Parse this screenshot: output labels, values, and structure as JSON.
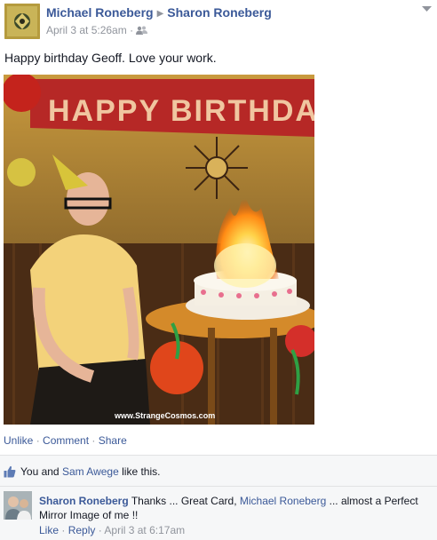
{
  "post": {
    "author": "Michael Roneberg",
    "arrow_glyph": "▶",
    "recipient": "Sharon Roneberg",
    "timestamp": "April 3 at 5:26am",
    "meta_separator": "·",
    "audience_icon": "friends-icon",
    "menu_icon": "chevron-down-icon",
    "message": "Happy birthday Geoff. Love your work.",
    "photo": {
      "banner_text": "HAPPY BIRTHDAY",
      "watermark": "www.StrangeCosmos.com"
    },
    "actions": {
      "like": "Unlike",
      "comment": "Comment",
      "share": "Share",
      "separator": "·"
    }
  },
  "likes": {
    "icon": "thumbs-up-icon",
    "prefix": "You and",
    "person": "Sam Awege",
    "suffix": "like this."
  },
  "comment": {
    "author": "Sharon Roneberg",
    "text_before": "Thanks ... Great Card,",
    "mention": "Michael Roneberg",
    "text_after": "... almost a Perfect Mirror Image of me !!",
    "like_label": "Like",
    "reply_label": "Reply",
    "separator": "·",
    "timestamp": "April 3 at 6:17am"
  },
  "colors": {
    "link": "#3b5998",
    "muted": "#90949c",
    "ufi_background": "#f6f7f8"
  }
}
